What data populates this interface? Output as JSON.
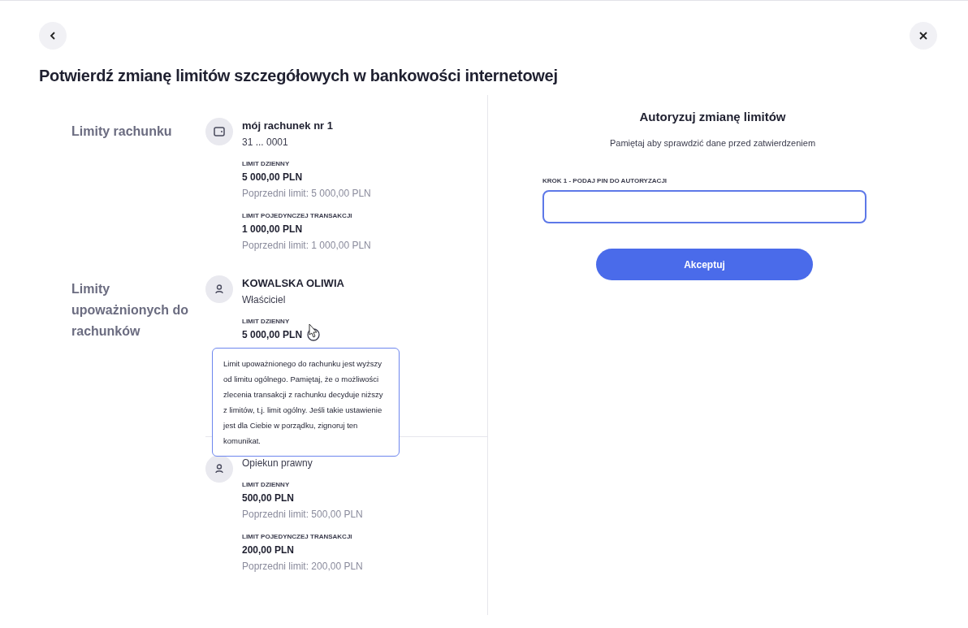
{
  "title": "Potwierdź zmianę limitów szczegółowych w bankowości internetowej",
  "sections": [
    {
      "label": "Limity rachunku",
      "entries": [
        {
          "kind": "account",
          "name": "mój rachunek nr 1",
          "subtitle": "31 ... 0001",
          "limits": [
            {
              "label": "LIMIT DZIENNY",
              "value": "5 000,00 PLN",
              "previous": "Poprzedni limit: 5 000,00 PLN",
              "info": false
            },
            {
              "label": "LIMIT POJEDYNCZEJ TRANSAKCJI",
              "value": "1 000,00 PLN",
              "previous": "Poprzedni limit: 1 000,00 PLN",
              "info": false
            }
          ]
        }
      ]
    },
    {
      "label": "Limity upoważnionych do rachunków",
      "entries": [
        {
          "kind": "person",
          "name": "KOWALSKA OLIWIA",
          "subtitle": "Właściciel",
          "limits": [
            {
              "label": "LIMIT DZIENNY",
              "value": "5 000,00 PLN",
              "info": true
            }
          ]
        },
        {
          "kind": "person",
          "subtitle": "Opiekun prawny",
          "limits": [
            {
              "label": "LIMIT DZIENNY",
              "value": "500,00 PLN",
              "previous": "Poprzedni limit: 500,00 PLN",
              "info": false
            },
            {
              "label": "LIMIT POJEDYNCZEJ TRANSAKCJI",
              "value": "200,00 PLN",
              "previous": "Poprzedni limit: 200,00 PLN",
              "info": false
            }
          ]
        }
      ]
    }
  ],
  "tooltip": {
    "text": "Limit upoważnionego do rachunku jest wyższy od limitu ogólnego. Pamiętaj, że o możliwości zlecenia transakcji z rachunku decyduje niższy z limitów, t.j. limit ogólny. Jeśli takie ustawienie jest dla Ciebie w porządku, zignoruj ten komunikat."
  },
  "auth": {
    "title": "Autoryzuj zmianę limitów",
    "hint": "Pamiętaj aby sprawdzić dane przed zatwierdzeniem",
    "pin_label": "KROK 1 - PODAJ PIN DO AUTORYZACJI",
    "button": "Akceptuj"
  }
}
